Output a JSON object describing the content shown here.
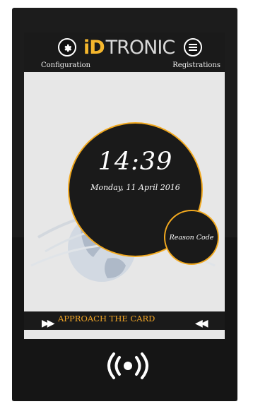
{
  "header": {
    "logo_id": "iD",
    "logo_rest": "TRONIC",
    "configuration_label": "Configuration",
    "registrations_label": "Registrations"
  },
  "clock": {
    "time": "14:39",
    "date": "Monday, 11 April 2016"
  },
  "reason_code_label": "Reason Code",
  "status": {
    "message": "APPROACH THE CARD",
    "left_arrows": "▶▶",
    "right_arrows": "◀◀"
  },
  "icons": [
    "gear-icon",
    "menu-icon",
    "globe-watermark",
    "nfc-icon"
  ],
  "colors": {
    "accent": "#f2a91f",
    "bar": "#1a1a1a",
    "screen_bg": "#e7e7e7"
  }
}
